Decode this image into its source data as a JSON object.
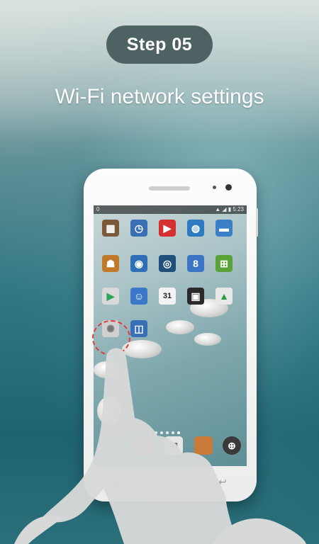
{
  "header": {
    "step": "Step 05",
    "subtitle": "Wi-Fi network settings"
  },
  "phone": {
    "status_left": "0",
    "status_right": "▲ ◢ ▮ 5:23"
  },
  "colors": {
    "badge": "#4f6263",
    "highlight": "#e53a3a",
    "hand": "#d7d8d8"
  },
  "icons": {
    "menu": "≡",
    "back": "↩",
    "calendar": "31"
  }
}
